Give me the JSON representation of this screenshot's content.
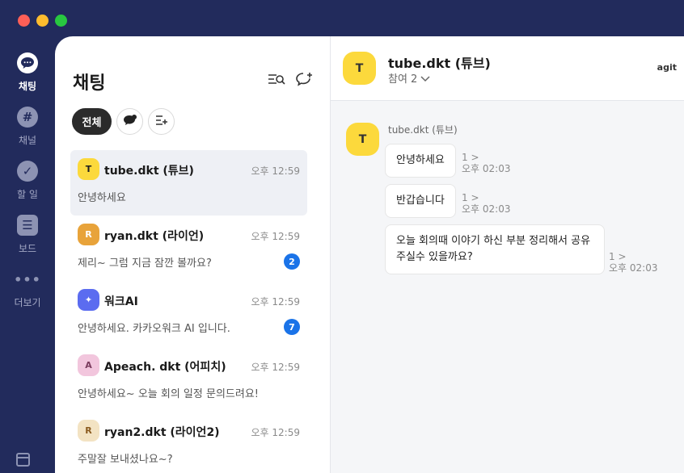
{
  "rail": {
    "items": [
      {
        "label": "채팅",
        "icon": "chat-bubble-icon"
      },
      {
        "label": "채널",
        "icon": "hash-icon",
        "glyph": "#"
      },
      {
        "label": "할 일",
        "icon": "check-icon",
        "glyph": "✓"
      },
      {
        "label": "보드",
        "icon": "board-icon",
        "glyph": "☰"
      },
      {
        "label": "더보기",
        "icon": "more-icon",
        "glyph": "•••"
      }
    ]
  },
  "list": {
    "title": "채팅",
    "filters": {
      "all_label": "전체"
    },
    "chats": [
      {
        "name": "tube.dkt (튜브)",
        "time": "오후 12:59",
        "preview": "안녕하세요",
        "badge": "",
        "avatar_color": "#fcd93c",
        "avatar_glyph": "T"
      },
      {
        "name": "ryan.dkt (라이언)",
        "time": "오후 12:59",
        "preview": "제리~ 그럼 지금 잠깐 볼까요?",
        "badge": "2",
        "avatar_color": "#e8a33a",
        "avatar_glyph": "R"
      },
      {
        "name": "워크AI",
        "time": "오후 12:59",
        "preview": "안녕하세요. 카카오워크 AI 입니다.",
        "badge": "7",
        "avatar_color": "#5b6cf0",
        "avatar_glyph": "✦"
      },
      {
        "name": "Apeach. dkt (어피치)",
        "time": "오후 12:59",
        "preview": "안녕하세요~ 오늘 회의 일정 문의드려요!",
        "badge": "",
        "avatar_color": "#f2c6dd",
        "avatar_glyph": "A"
      },
      {
        "name": "ryan2.dkt (라이언2)",
        "time": "오후 12:59",
        "preview": "주말잘 보내셨나요~?",
        "badge": "",
        "avatar_color": "#f3e3c3",
        "avatar_glyph": "R"
      }
    ]
  },
  "conversation": {
    "title": "tube.dkt (튜브)",
    "participants": "참여 2",
    "brand": "agit",
    "sender": "tube.dkt (튜브)",
    "messages": [
      {
        "text": "안녕하세요",
        "count": "1 >",
        "time": "오후 02:03"
      },
      {
        "text": "반갑습니다",
        "count": "1 >",
        "time": "오후 02:03"
      },
      {
        "text_line1": "오늘 회의때 이야기 하신 부분 정리해서 공유",
        "text_line2": "주실수 있을까요?",
        "count": "1 >",
        "time": "오후 02:03"
      }
    ]
  }
}
